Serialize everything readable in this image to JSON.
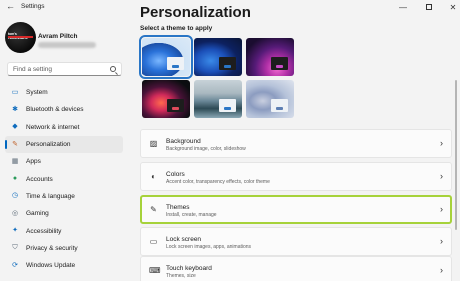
{
  "window": {
    "title": "Settings",
    "back_glyph": "←",
    "minimize_glyph": "—",
    "close_glyph": "✕"
  },
  "profile": {
    "name": "Avram Piltch",
    "avatar_text": "tom's HARDWARE"
  },
  "search": {
    "placeholder": "Find a setting"
  },
  "nav": {
    "items": [
      {
        "label": "System",
        "icon": "monitor-icon",
        "glyph": "▭",
        "color": "#0f6cbd"
      },
      {
        "label": "Bluetooth & devices",
        "icon": "bluetooth-icon",
        "glyph": "✱",
        "color": "#0f6cbd"
      },
      {
        "label": "Network & internet",
        "icon": "wifi-icon",
        "glyph": "◆",
        "color": "#0f6cbd"
      },
      {
        "label": "Personalization",
        "icon": "brush-icon",
        "glyph": "✎",
        "color": "#c0622b"
      },
      {
        "label": "Apps",
        "icon": "apps-icon",
        "glyph": "▦",
        "color": "#5d6b78"
      },
      {
        "label": "Accounts",
        "icon": "person-icon",
        "glyph": "●",
        "color": "#2b9b5b"
      },
      {
        "label": "Time & language",
        "icon": "clock-icon",
        "glyph": "◷",
        "color": "#0f6cbd"
      },
      {
        "label": "Gaming",
        "icon": "controller-icon",
        "glyph": "◎",
        "color": "#5d6b78"
      },
      {
        "label": "Accessibility",
        "icon": "accessibility-icon",
        "glyph": "✦",
        "color": "#0f6cbd"
      },
      {
        "label": "Privacy & security",
        "icon": "shield-icon",
        "glyph": "⛉",
        "color": "#5d6b78"
      },
      {
        "label": "Windows Update",
        "icon": "update-icon",
        "glyph": "⟳",
        "color": "#0f6cbd"
      }
    ],
    "active_index": 3,
    "accent_color": "#0067c0"
  },
  "main": {
    "title": "Personalization",
    "theme_heading": "Select a theme to apply",
    "themes": [
      {
        "name": "windows-light",
        "selected": true
      },
      {
        "name": "windows-dark",
        "selected": false
      },
      {
        "name": "glow",
        "selected": false
      },
      {
        "name": "captured-motion",
        "selected": false
      },
      {
        "name": "sunrise",
        "selected": false
      },
      {
        "name": "flow",
        "selected": false
      }
    ],
    "cards": [
      {
        "title": "Background",
        "subtitle": "Background image, color, slideshow",
        "icon": "image-icon",
        "glyph": "▨"
      },
      {
        "title": "Colors",
        "subtitle": "Accent color, transparency effects, color theme",
        "icon": "palette-icon",
        "glyph": "◐"
      },
      {
        "title": "Themes",
        "subtitle": "Install, create, manage",
        "icon": "brush-icon",
        "glyph": "✎"
      },
      {
        "title": "Lock screen",
        "subtitle": "Lock screen images, apps, animations",
        "icon": "lock-screen-icon",
        "glyph": "▭"
      },
      {
        "title": "Touch keyboard",
        "subtitle": "Themes, size",
        "icon": "keyboard-icon",
        "glyph": "⌨"
      }
    ],
    "chevron_glyph": "›",
    "highlight_color": "#a6d23a"
  }
}
